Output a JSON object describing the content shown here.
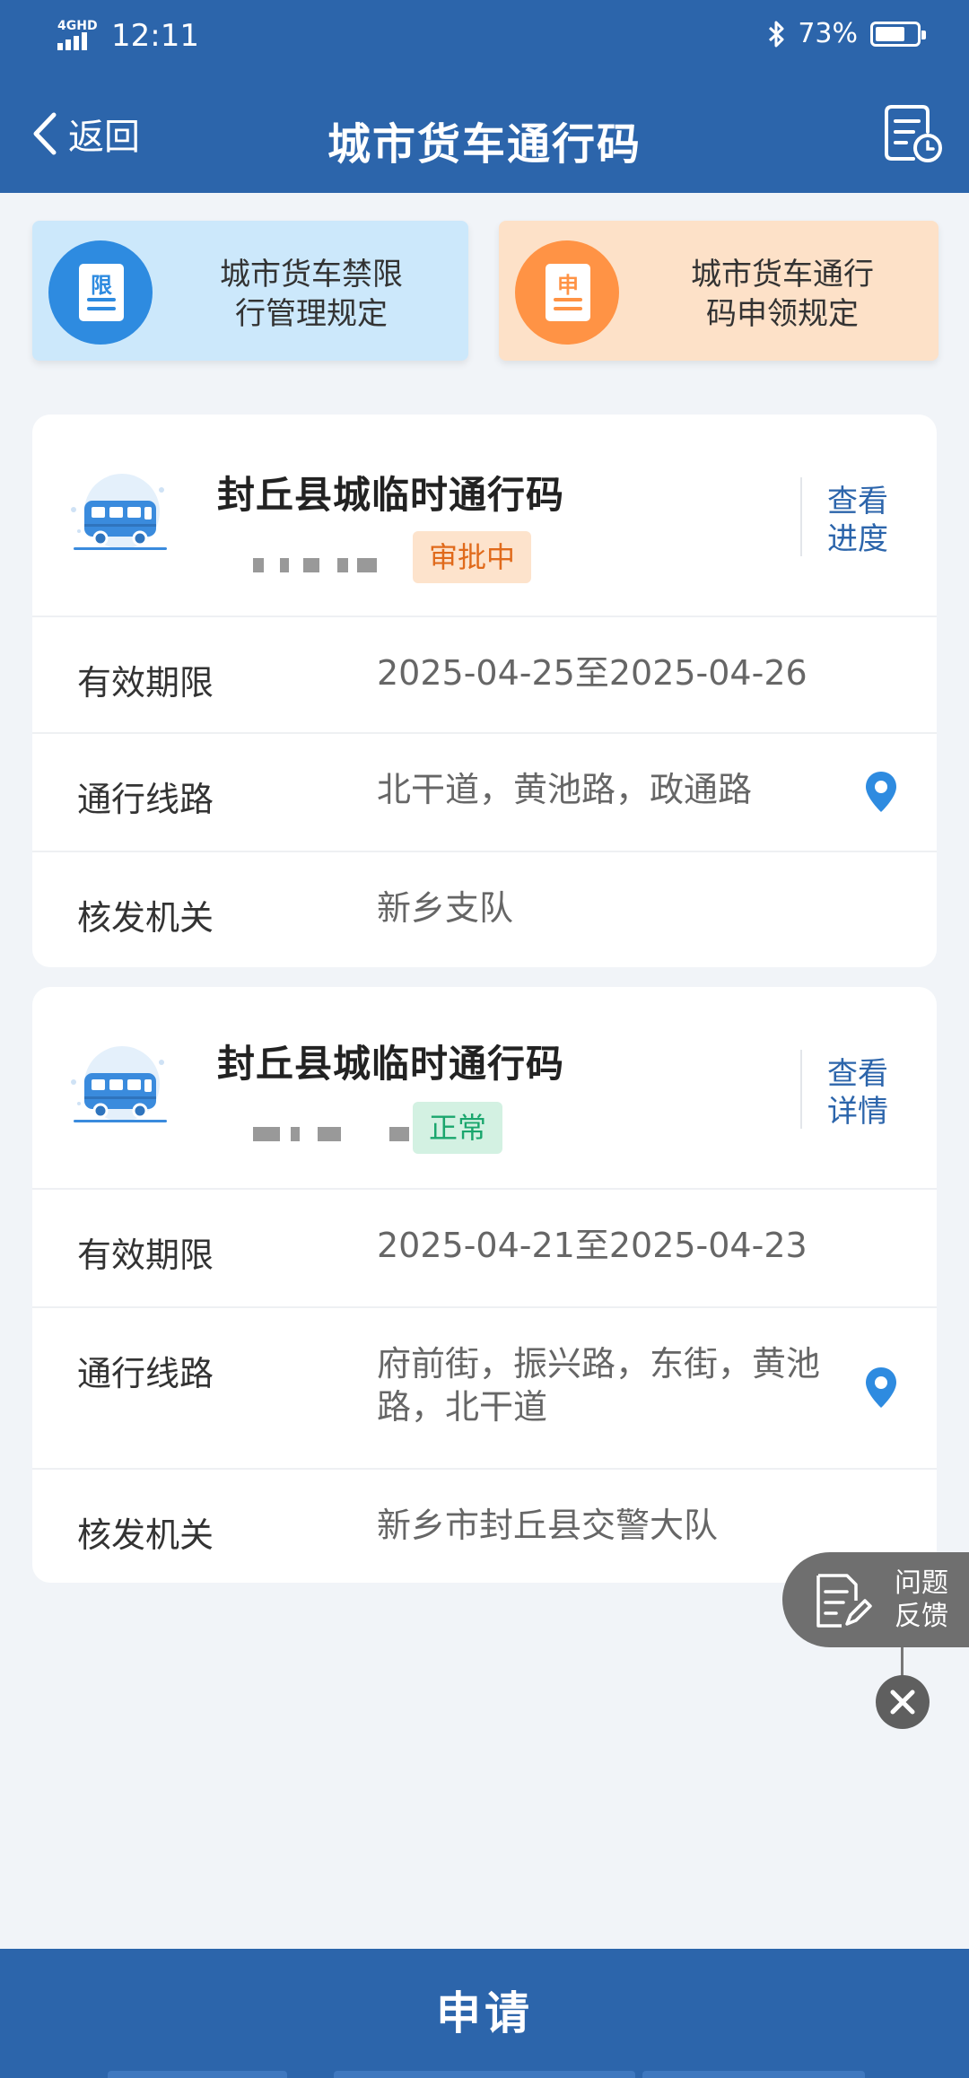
{
  "status_bar": {
    "network": "4GHD",
    "time": "12:11",
    "battery": "73%",
    "battery_level": 0.73
  },
  "nav": {
    "back_label": "返回",
    "title": "城市货车通行码",
    "history_icon": "document-clock-icon"
  },
  "rules": [
    {
      "icon_char": "限",
      "label_line1": "城市货车禁限",
      "label_line2": "行管理规定",
      "color": "#2e8be0"
    },
    {
      "icon_char": "申",
      "label_line1": "城市货车通行",
      "label_line2": "码申领规定",
      "color": "#ff9345"
    }
  ],
  "permits": [
    {
      "name": "封丘县城临时通行码",
      "status": "审批中",
      "action_line1": "查看",
      "action_line2": "进度",
      "validity_label": "有效期限",
      "validity": "2025-04-25至2025-04-26",
      "route_label": "通行线路",
      "route": "北干道，黄池路，政通路",
      "issuer_label": "核发机关",
      "issuer": "新乡支队"
    },
    {
      "name": "封丘县城临时通行码",
      "status": "正常",
      "action_line1": "查看",
      "action_line2": "详情",
      "validity_label": "有效期限",
      "validity": "2025-04-21至2025-04-23",
      "route_label": "通行线路",
      "route": "府前街，振兴路，东街，黄池路，北干道",
      "issuer_label": "核发机关",
      "issuer": "新乡市封丘县交警大队"
    }
  ],
  "feedback": {
    "line1": "问题",
    "line2": "反馈"
  },
  "apply_label": "申请",
  "colors": {
    "primary": "#2c65ab",
    "pending_text": "#e06a1b",
    "normal_text": "#1aa66d",
    "pin": "#2e8be0"
  }
}
